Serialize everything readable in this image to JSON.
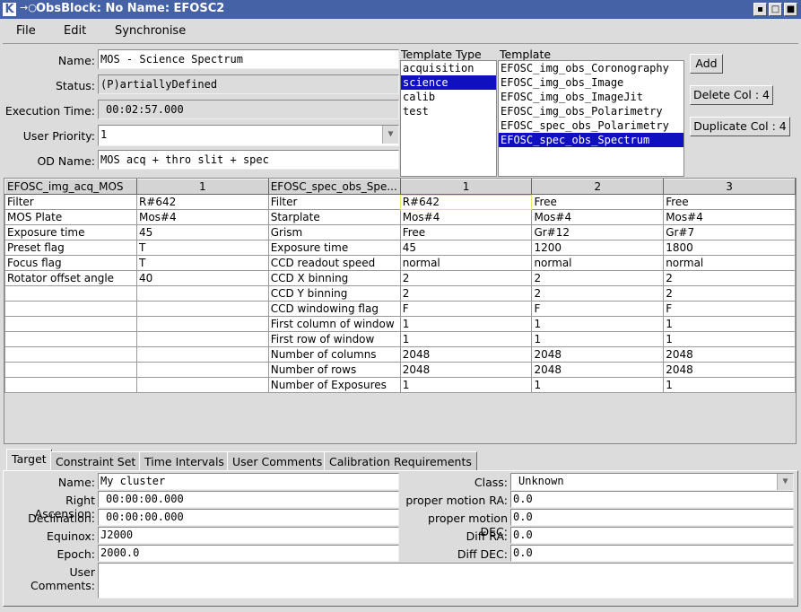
{
  "window": {
    "title": "ObsBlock: No Name: EFOSC2",
    "app_icon": "K"
  },
  "menu": [
    "File",
    "Edit",
    "Synchronise"
  ],
  "form": {
    "name_label": "Name:",
    "name_value": "MOS - Science Spectrum",
    "status_label": "Status:",
    "status_value": "(P)artiallyDefined",
    "exec_label": "Execution Time:",
    "exec_value": "00:02:57.000",
    "priority_label": "User Priority:",
    "priority_value": "1",
    "od_label": "OD Name:",
    "od_value": "MOS acq + thro slit + spec"
  },
  "template_type": {
    "header": "Template Type",
    "items": [
      "acquisition",
      "science",
      "calib",
      "test"
    ],
    "selected": 1
  },
  "template": {
    "header": "Template",
    "items": [
      "EFOSC_img_obs_Coronography",
      "EFOSC_img_obs_Image",
      "EFOSC_img_obs_ImageJit",
      "EFOSC_img_obs_Polarimetry",
      "EFOSC_spec_obs_Polarimetry",
      "EFOSC_spec_obs_Spectrum"
    ],
    "selected": 5
  },
  "buttons": {
    "add": "Add",
    "delete_col": "Delete Col : 4",
    "duplicate_col": "Duplicate Col : 4"
  },
  "grid": {
    "headers": [
      "EFOSC_img_acq_MOS",
      "1",
      "EFOSC_spec_obs_Spe...",
      "1",
      "2",
      "3"
    ],
    "rows": [
      [
        "Filter",
        "R#642",
        "Filter",
        "R#642",
        "Free",
        "Free"
      ],
      [
        "MOS Plate",
        "Mos#4",
        "Starplate",
        "Mos#4",
        "Mos#4",
        "Mos#4"
      ],
      [
        "Exposure time",
        "45",
        "Grism",
        "Free",
        "Gr#12",
        "Gr#7"
      ],
      [
        "Preset flag",
        "T",
        "Exposure time",
        "45",
        "1200",
        "1800"
      ],
      [
        "Focus flag",
        "T",
        "CCD readout speed",
        "normal",
        "normal",
        "normal"
      ],
      [
        "Rotator offset angle",
        "40",
        "CCD X binning",
        "2",
        "2",
        "2"
      ],
      [
        "",
        "",
        "CCD Y binning",
        "2",
        "2",
        "2"
      ],
      [
        "",
        "",
        "CCD windowing flag",
        "F",
        "F",
        "F"
      ],
      [
        "",
        "",
        "First column of window",
        "1",
        "1",
        "1"
      ],
      [
        "",
        "",
        "First row of window",
        "1",
        "1",
        "1"
      ],
      [
        "",
        "",
        "Number of columns",
        "2048",
        "2048",
        "2048"
      ],
      [
        "",
        "",
        "Number of rows",
        "2048",
        "2048",
        "2048"
      ],
      [
        "",
        "",
        "Number of Exposures",
        "1",
        "1",
        "1"
      ]
    ]
  },
  "tabs": [
    "Target",
    "Constraint Set",
    "Time Intervals",
    "User Comments",
    "Calibration Requirements"
  ],
  "target": {
    "name_label": "Name:",
    "name_value": "My cluster",
    "ra_label": "Right Ascension:",
    "ra_value": "00:00:00.000",
    "dec_label": "Declination:",
    "dec_value": "00:00:00.000",
    "equinox_label": "Equinox:",
    "equinox_value": "J2000",
    "epoch_label": "Epoch:",
    "epoch_value": "2000.0",
    "comments_label": "User Comments:",
    "comments_value": "",
    "class_label": "Class:",
    "class_value": "Unknown",
    "pmra_label": "proper motion RA:",
    "pmra_value": "0.0",
    "pmdec_label": "proper motion DEC:",
    "pmdec_value": "0.0",
    "diffra_label": "Diff RA:",
    "diffra_value": "0.0",
    "diffdec_label": "Diff DEC:",
    "diffdec_value": "0.0"
  }
}
